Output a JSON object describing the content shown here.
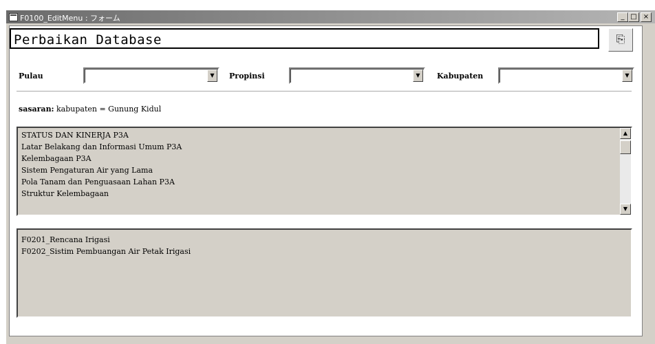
{
  "window": {
    "title": "F0100_EditMenu : フォーム",
    "minimize_label": "_",
    "maximize_label": "□",
    "close_label": "×"
  },
  "header": {
    "title": "Perbaikan Database",
    "exit_icon_glyph": "⎘"
  },
  "filters": {
    "pulau_label": "Pulau",
    "pulau_value": "",
    "propinsi_label": "Propinsi",
    "propinsi_value": "",
    "kabupaten_label": "Kabupaten",
    "kabupaten_value": ""
  },
  "sasaran": {
    "label": "sasaran:",
    "value": "kabupaten = Gunung Kidul"
  },
  "menu_list": {
    "items": [
      "STATUS DAN KINERJA P3A",
      "Latar Belakang dan Informasi Umum P3A",
      "Kelembagaan P3A",
      "Sistem Pengaturan Air yang Lama",
      "Pola Tanam dan Penguasaan Lahan P3A",
      "Struktur Kelembagaan"
    ]
  },
  "form_list": {
    "items": [
      "F0201_Rencana Irigasi",
      "F0202_Sistim Pembuangan Air Petak Irigasi"
    ]
  },
  "icons": {
    "scroll_up": "▲",
    "scroll_down": "▼",
    "combo_arrow": "▼"
  }
}
